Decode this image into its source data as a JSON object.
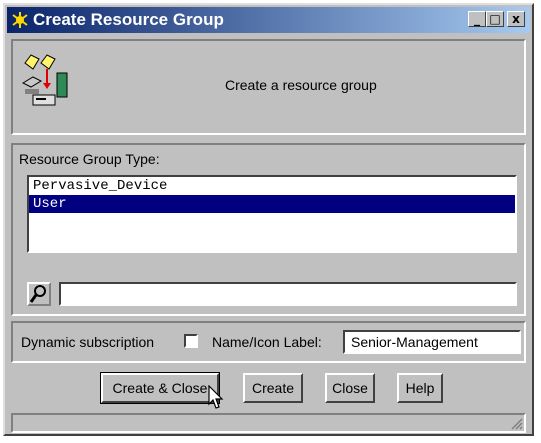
{
  "window": {
    "title": "Create Resource Group"
  },
  "title_buttons": {
    "minimize": "_",
    "maximize": "□",
    "close": "x"
  },
  "header": {
    "description": "Create a resource group"
  },
  "resource_group": {
    "label": "Resource Group Type:",
    "items": [
      {
        "label": "Pervasive_Device",
        "selected": false
      },
      {
        "label": "User",
        "selected": true
      }
    ],
    "search_value": ""
  },
  "options": {
    "dynamic_subscription_label": "Dynamic subscription",
    "dynamic_subscription_checked": false,
    "name_label": "Name/Icon Label:",
    "name_value": "Senior-Management"
  },
  "buttons": {
    "create_close": "Create & Close",
    "create": "Create",
    "close": "Close",
    "help": "Help"
  },
  "colors": {
    "title_start": "#0a246a",
    "title_end": "#a6caf0",
    "selection": "#000080",
    "face": "#c0c0c0"
  }
}
